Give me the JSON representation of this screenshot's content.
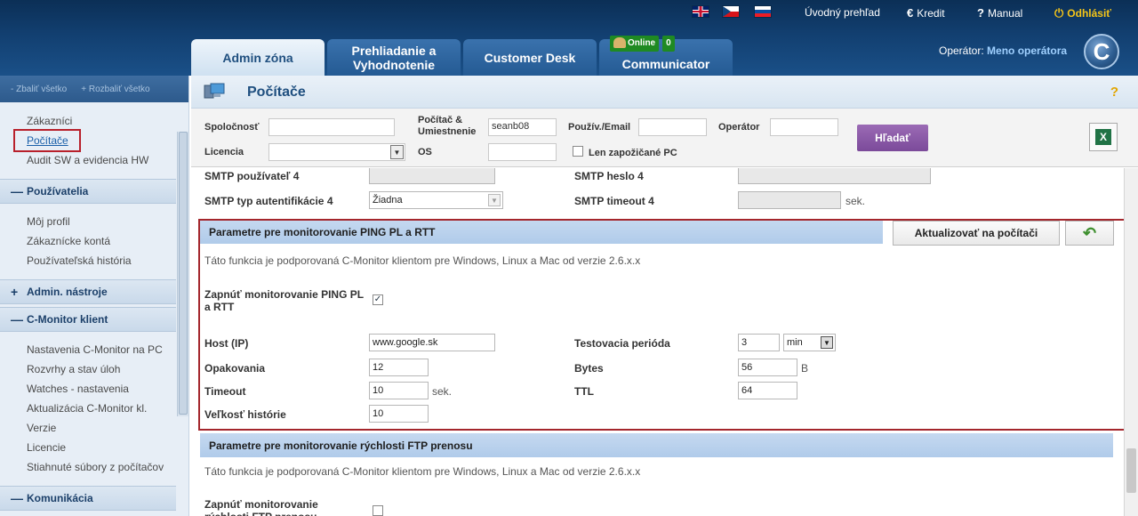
{
  "header": {
    "nav_links": {
      "overview": "Úvodný prehľad",
      "credit": "Kredit",
      "manual": "Manual",
      "logout": "Odhlásiť"
    },
    "tabs": [
      {
        "label": "Admin zóna",
        "active": true
      },
      {
        "label": "Prehliadanie a Vyhodnotenie",
        "active": false
      },
      {
        "label": "Customer Desk",
        "active": false
      },
      {
        "label": "Communicator",
        "active": false
      }
    ],
    "online_status": "Online",
    "online_count": "0",
    "operator_label": "Operátor:",
    "operator_name": "Meno operátora",
    "logo_letter": "C"
  },
  "sidebar": {
    "collapse_all": "Zbaliť všetko",
    "expand_all": "Rozbaliť všetko",
    "items_top": [
      "Zákazníci",
      "Počítače",
      "Audit SW a evidencia HW"
    ],
    "sections": {
      "users": "Používatelia",
      "admin_tools": "Admin. nástroje",
      "cmonitor": "C-Monitor klient",
      "communication": "Komunikácia"
    },
    "users_items": [
      "Môj profil",
      "Zákaznícke kontá",
      "Používateľská história"
    ],
    "cmonitor_items": [
      "Nastavenia C-Monitor na PC",
      "Rozvrhy a stav úloh",
      "Watches - nastavenia",
      "Aktualizácia C-Monitor kl.",
      "Verzie",
      "Licencie",
      "Stiahnuté súbory z počítačov"
    ]
  },
  "page": {
    "title": "Počítače",
    "help": "?"
  },
  "filter": {
    "company_label": "Spoločnosť",
    "computer_label": "Počítač & Umiestnenie",
    "computer_value": "seanb08",
    "user_label": "Použív./Email",
    "operator_label": "Operátor",
    "license_label": "Licencia",
    "os_label": "OS",
    "borrowed_label": "Len zapožičané PC",
    "search_button": "Hľadať"
  },
  "smtp": {
    "user4_label": "SMTP používateľ 4",
    "password4_label": "SMTP heslo 4",
    "auth4_label": "SMTP typ autentifikácie 4",
    "auth4_value": "Žiadna",
    "timeout4_label": "SMTP timeout 4",
    "sec_unit": "sek."
  },
  "ping": {
    "header": "Parametre pre monitorovanie PING PL a RTT",
    "update_button": "Aktualizovať na počítači",
    "info": "Táto funkcia je podporovaná C-Monitor klientom pre Windows, Linux a Mac od verzie 2.6.x.x",
    "enable_label": "Zapnúť monitorovanie PING PL a RTT",
    "enabled": true,
    "host_label": "Host (IP)",
    "host_value": "www.google.sk",
    "period_label": "Testovacia perióda",
    "period_value": "3",
    "period_unit": "min",
    "repeat_label": "Opakovania",
    "repeat_value": "12",
    "bytes_label": "Bytes",
    "bytes_value": "56",
    "bytes_unit": "B",
    "timeout_label": "Timeout",
    "timeout_value": "10",
    "timeout_unit": "sek.",
    "ttl_label": "TTL",
    "ttl_value": "64",
    "history_label": "Veľkosť histórie",
    "history_value": "10"
  },
  "ftp": {
    "header": "Parametre pre monitorovanie rýchlosti FTP prenosu",
    "info": "Táto funkcia je podporovaná C-Monitor klientom pre Windows, Linux a Mac od verzie 2.6.x.x",
    "enable_label": "Zapnúť monitorovanie rýchlosti FTP prenosu",
    "enabled": false
  },
  "colors": {
    "accent": "#1f4f7f",
    "highlight": "#a4262c",
    "search_button": "#8a5aa8"
  }
}
